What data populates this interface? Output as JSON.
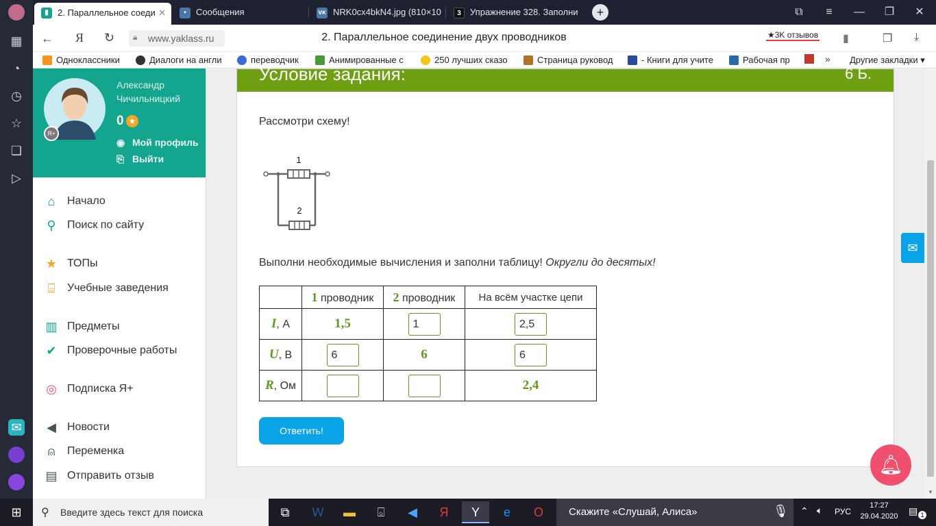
{
  "tabs": [
    {
      "label": "2. Параллельное соеди",
      "active": true
    },
    {
      "label": "Сообщения"
    },
    {
      "label": "NRK0cx4bkN4.jpg (810×10"
    },
    {
      "label": "Упражнение 328. Заполни"
    }
  ],
  "address": {
    "domain": "www.yaklass.ru",
    "page_title": "2. Параллельное соединение двух проводников",
    "reviews": "★3K отзывов"
  },
  "bookmarks": [
    "Одноклассники",
    "Диалоги на англи",
    "переводчик",
    "Анимированные с",
    "250 лучших сказо",
    "Страница руковод",
    "- Книги для учите",
    "Рабочая пр",
    "Другие закладки"
  ],
  "profile": {
    "name_line1": "Александр",
    "name_line2": "Чичильницкий",
    "points": "0",
    "my_profile": "Мой профиль",
    "logout": "Выйти",
    "badge": "Я+"
  },
  "nav": [
    {
      "label": "Начало",
      "icon": "home-icon"
    },
    {
      "label": "Поиск по сайту",
      "icon": "search-icon"
    },
    {
      "label": "ТОПы",
      "icon": "star-icon"
    },
    {
      "label": "Учебные заведения",
      "icon": "school-icon"
    },
    {
      "label": "Предметы",
      "icon": "book-icon"
    },
    {
      "label": "Проверочные работы",
      "icon": "check-icon"
    },
    {
      "label": "Подписка Я+",
      "icon": "subscription-icon"
    },
    {
      "label": "Новости",
      "icon": "megaphone-icon"
    },
    {
      "label": "Переменка",
      "icon": "bell-icon"
    },
    {
      "label": "Отправить отзыв",
      "icon": "feedback-icon"
    }
  ],
  "task": {
    "header": "Условие задания:",
    "points": "6 Б.",
    "intro": "Рассмотри схему!",
    "instruction": "Выполни необходимые вычисления и заполни таблицу! ",
    "instruction_italic": "Округли до десятых!",
    "circuit": {
      "label1": "1",
      "label2": "2"
    },
    "submit": "Ответить!"
  },
  "table": {
    "headers": [
      {
        "num": "",
        "text": ""
      },
      {
        "num": "1",
        "text": " проводник"
      },
      {
        "num": "2",
        "text": " проводник"
      },
      {
        "num": "",
        "text": "На всём участке цепи"
      }
    ],
    "rows": [
      {
        "sym": "I",
        "unit": ", А",
        "c1": "1,5",
        "c1_input": false,
        "c2": "1",
        "c2_input": true,
        "c3": "2,5",
        "c3_input": true
      },
      {
        "sym": "U",
        "unit": ", В",
        "c1": "6",
        "c1_input": true,
        "c2": "6",
        "c2_input": false,
        "c3": "6",
        "c3_input": true
      },
      {
        "sym": "R",
        "unit": ", Ом",
        "c1": "",
        "c1_input": true,
        "c2": "",
        "c2_input": true,
        "c3": "2,4",
        "c3_input": false
      }
    ]
  },
  "taskbar": {
    "search_placeholder": "Введите здесь текст для поиска",
    "alice": "Скажите «Слушай, Алиса»",
    "lang": "РУС",
    "time": "17:27",
    "date": "29.04.2020",
    "notif": "1"
  },
  "colors": {
    "accent_green": "#13a58d",
    "task_green": "#6f9f12",
    "value_green": "#5d9b1e",
    "button_blue": "#0aa3e8",
    "bell_red": "#f0506e"
  }
}
